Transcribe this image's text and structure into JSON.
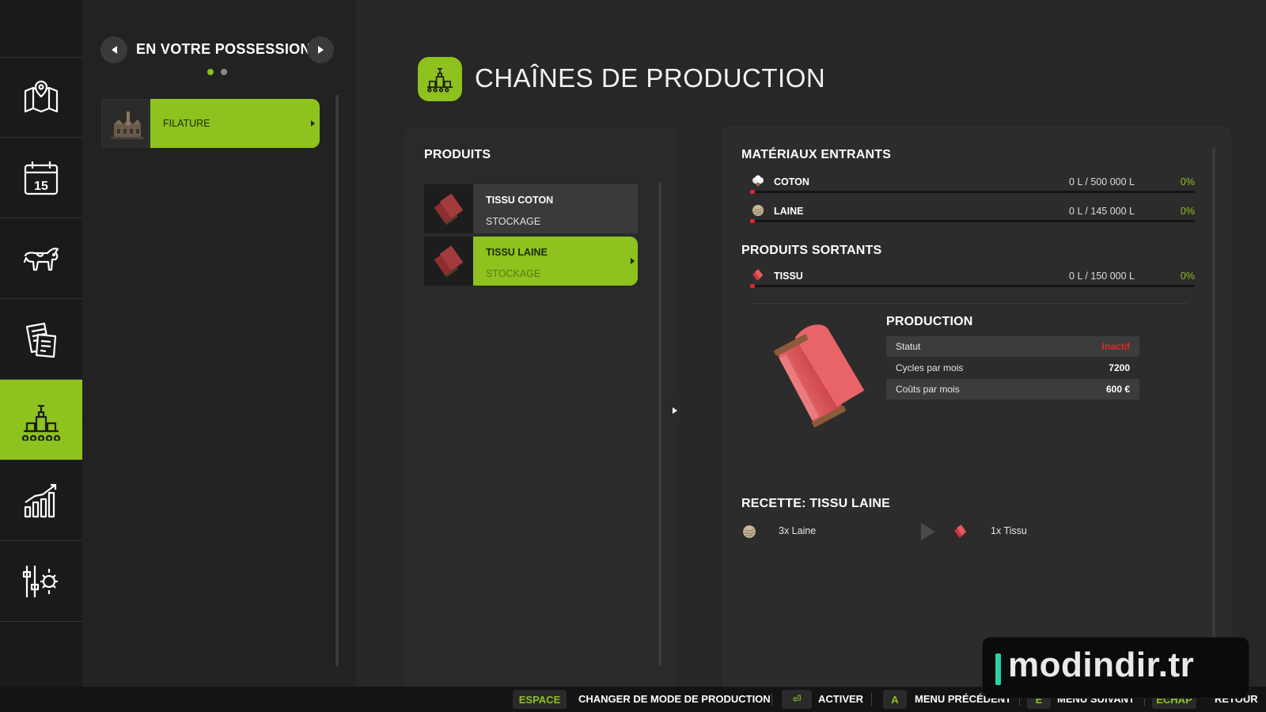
{
  "sidebar": {
    "items": [
      {
        "icon": "map-icon"
      },
      {
        "icon": "calendar-icon",
        "day": "15"
      },
      {
        "icon": "cow-icon"
      },
      {
        "icon": "contracts-icon"
      },
      {
        "icon": "production-icon",
        "active": true
      },
      {
        "icon": "statistics-icon"
      },
      {
        "icon": "settings-icon"
      }
    ]
  },
  "possession": {
    "title": "EN VOTRE POSSESSION",
    "page_count": 2,
    "current_page": 1,
    "items": [
      {
        "label": "FILATURE"
      }
    ]
  },
  "header": {
    "title": "CHAÎNES DE PRODUCTION",
    "icon": "production-icon"
  },
  "produits": {
    "title": "PRODUITS",
    "items": [
      {
        "name": "TISSU COTON",
        "sub": "STOCKAGE"
      },
      {
        "name": "TISSU LAINE",
        "sub": "STOCKAGE",
        "selected": true
      }
    ]
  },
  "details": {
    "inputs_title": "MATÉRIAUX ENTRANTS",
    "inputs": [
      {
        "name": "COTON",
        "amount": "0 L / 500 000 L",
        "percent": "0%",
        "fill": 0,
        "icon": "cotton-icon"
      },
      {
        "name": "LAINE",
        "amount": "0 L / 145 000 L",
        "percent": "0%",
        "fill": 0,
        "icon": "wool-icon"
      }
    ],
    "outputs_title": "PRODUITS SORTANTS",
    "outputs": [
      {
        "name": "TISSU",
        "amount": "0 L / 150 000 L",
        "percent": "0%",
        "fill": 0,
        "icon": "fabric-icon"
      }
    ],
    "production": {
      "title": "PRODUCTION",
      "rows": [
        {
          "key": "Statut",
          "value": "Inactif"
        },
        {
          "key": "Cycles par mois",
          "value": "7200"
        },
        {
          "key": "Coûts par mois",
          "value": "600 €"
        }
      ]
    },
    "recipe": {
      "title": "RECETTE: TISSU LAINE",
      "input": "3x Laine",
      "output": "1x Tissu"
    }
  },
  "footer": {
    "actions": [
      {
        "key": "ESPACE",
        "label": "CHANGER DE MODE DE PRODUCTION"
      },
      {
        "key": "⏎",
        "label": "ACTIVER"
      },
      {
        "key": "A",
        "label": "MENU PRÉCÉDENT"
      },
      {
        "key": "E",
        "label": "MENU SUIVANT"
      },
      {
        "key": "ECHAP",
        "label": "RETOUR"
      }
    ]
  },
  "watermark": {
    "text": "modindir.tr"
  },
  "colors": {
    "accent": "#8dc21f",
    "background": "#272727",
    "rail": "#1a1a1a",
    "status_inactive": "#e0272c",
    "fill_low": "#e0272c"
  }
}
